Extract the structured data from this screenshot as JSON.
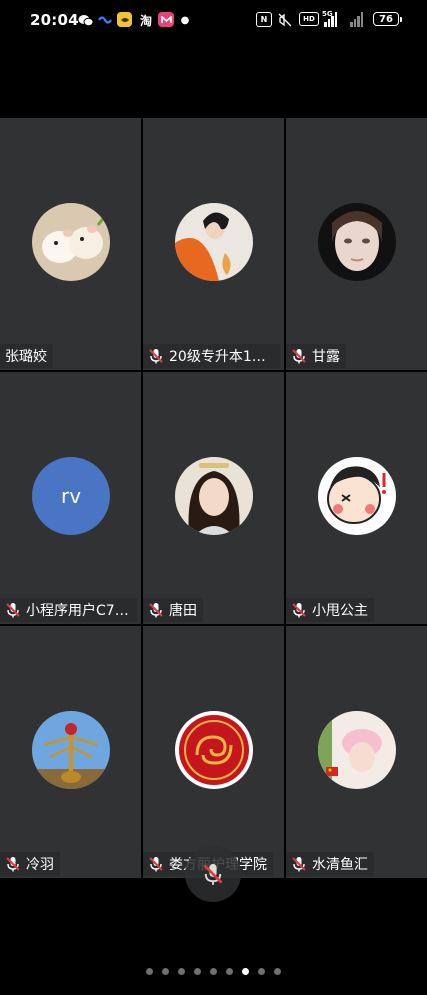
{
  "status_bar": {
    "time": "20:04",
    "apps": [
      "wechat-icon",
      "fish-icon",
      "yellow-app-icon",
      "taobao-icon",
      "pink-app-icon",
      "dot"
    ],
    "taobao_label": "淘",
    "hd_label": "HD",
    "network": "5G",
    "battery": "76"
  },
  "participants": [
    {
      "name": "张璐姣",
      "muted": false,
      "avatar": "hamsters-photo"
    },
    {
      "name": "20级专升本1班…",
      "muted": true,
      "avatar": "woman-orange-photo"
    },
    {
      "name": "甘露",
      "muted": true,
      "avatar": "child-face-photo"
    },
    {
      "name": "小程序用户C7w…",
      "muted": true,
      "avatar": "initials",
      "initials": "rv"
    },
    {
      "name": "唐田",
      "muted": true,
      "avatar": "woman-portrait-photo"
    },
    {
      "name": "小甩公主",
      "muted": true,
      "avatar": "cartoon-face"
    },
    {
      "name": "冷羽",
      "muted": true,
      "avatar": "sculpture-photo"
    },
    {
      "name": "娄方丽护理学院",
      "muted": true,
      "avatar": "red-gold-emblem"
    },
    {
      "name": "水清鱼汇",
      "muted": true,
      "avatar": "girl-pink-hat-photo"
    }
  ],
  "pager": {
    "count": 9,
    "active_index": 6
  },
  "colors": {
    "tile_bg": "#303233",
    "rv_avatar": "#4a74c4",
    "mute_red": "#e23b3b"
  }
}
